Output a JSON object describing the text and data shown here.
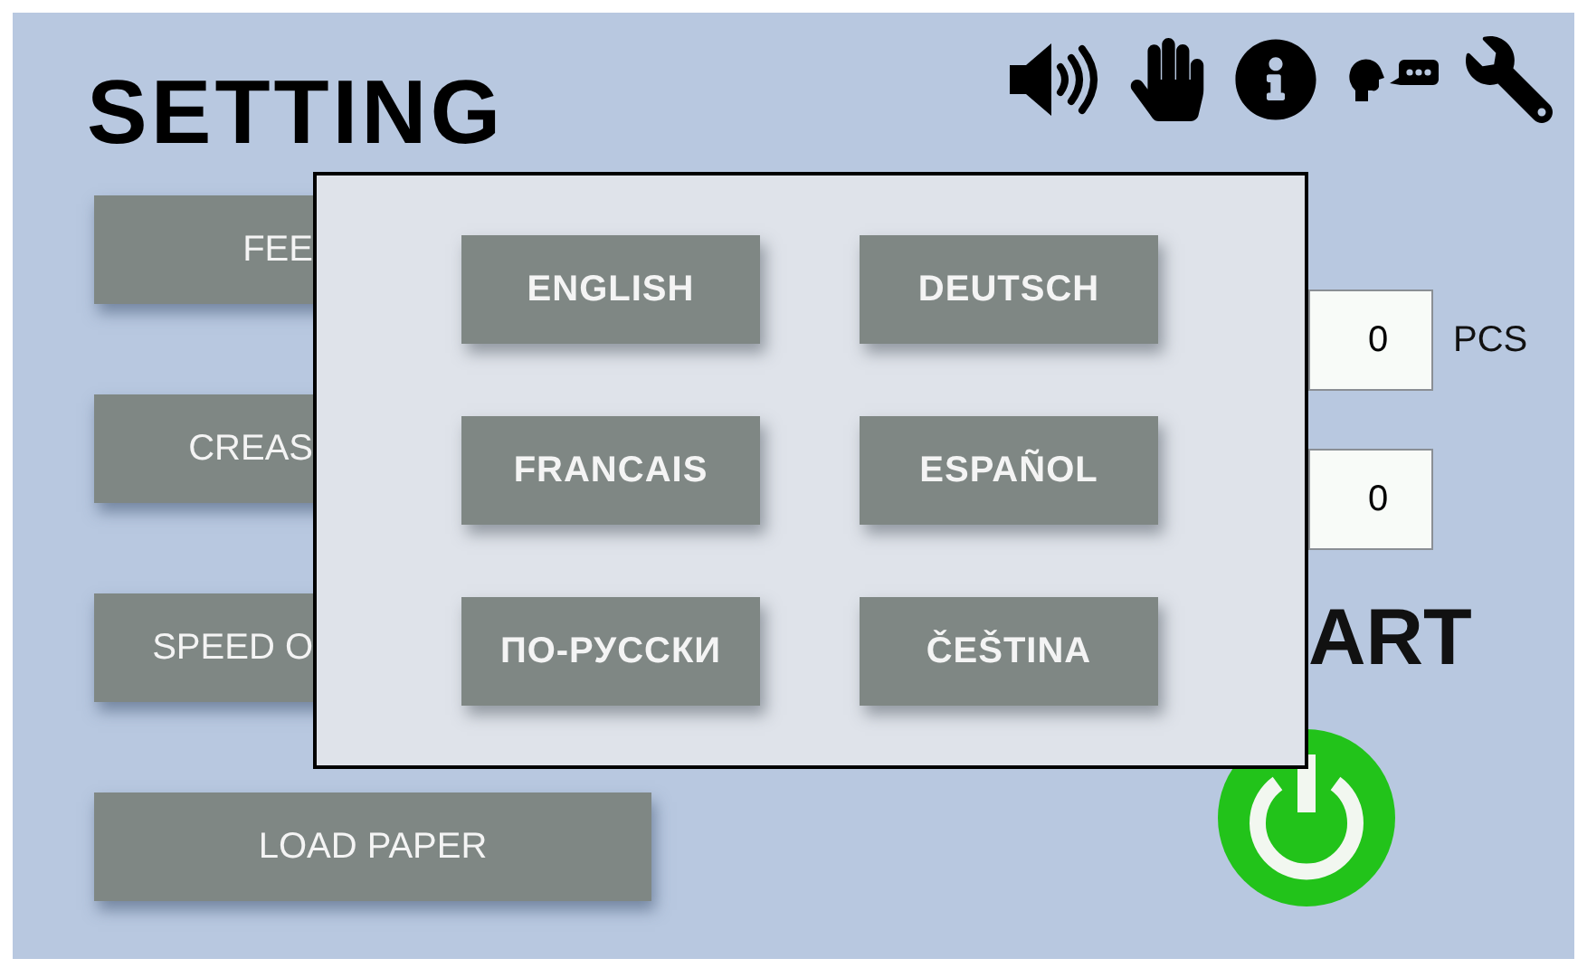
{
  "header": {
    "title": "SETTING"
  },
  "menu_buttons": [
    {
      "label": "FEE",
      "kind": "covered"
    },
    {
      "label": "CREAS",
      "kind": "covered"
    },
    {
      "label": "SPEED O",
      "kind": "covered"
    },
    {
      "label": "LOAD PAPER",
      "kind": "full"
    }
  ],
  "counters": [
    {
      "value": "0",
      "unit": "PCS"
    },
    {
      "value": "0"
    }
  ],
  "start": {
    "label": "ART"
  },
  "language_dialog": {
    "options": [
      "ENGLISH",
      "DEUTSCH",
      "FRANCAIS",
      "ESPAÑOL",
      "ПО-РУССКИ",
      "ČEŠTINA"
    ]
  }
}
